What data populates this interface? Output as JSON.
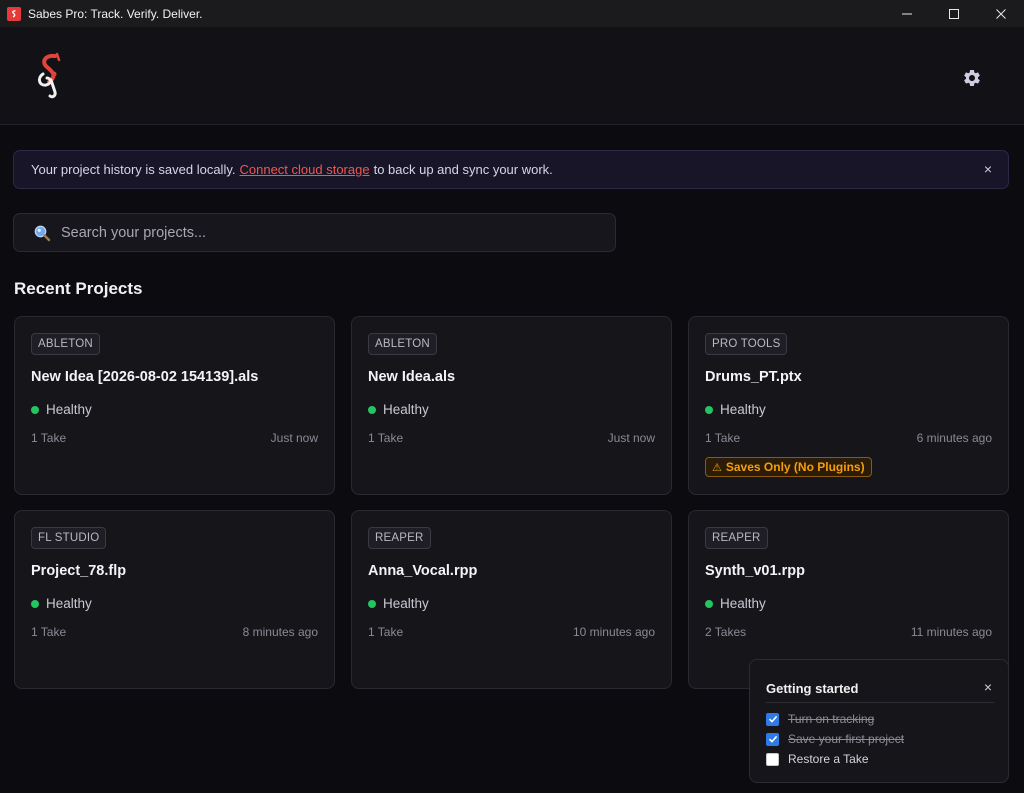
{
  "window": {
    "title": "Sabes Pro: Track. Verify. Deliver."
  },
  "header": {
    "logo_icon": "sabes-logo-icon",
    "settings_icon": "gear-icon"
  },
  "banner": {
    "text_before": "Your project history is saved locally.",
    "link": "Connect cloud storage",
    "text_after": "to back up and sync your work.",
    "close": "×"
  },
  "search": {
    "placeholder": "Search your projects..."
  },
  "recent": {
    "heading": "Recent Projects",
    "projects": [
      {
        "daw": "ABLETON",
        "name": "New Idea [2026-08-02 154139].als",
        "status": "Healthy",
        "takes": "1 Take",
        "time": "Just now"
      },
      {
        "daw": "ABLETON",
        "name": "New Idea.als",
        "status": "Healthy",
        "takes": "1 Take",
        "time": "Just now"
      },
      {
        "daw": "PRO TOOLS",
        "name": "Drums_PT.ptx",
        "status": "Healthy",
        "takes": "1 Take",
        "time": "6 minutes ago",
        "warning": "Saves Only (No Plugins)"
      },
      {
        "daw": "FL STUDIO",
        "name": "Project_78.flp",
        "status": "Healthy",
        "takes": "1 Take",
        "time": "8 minutes ago"
      },
      {
        "daw": "REAPER",
        "name": "Anna_Vocal.rpp",
        "status": "Healthy",
        "takes": "1 Take",
        "time": "10 minutes ago"
      },
      {
        "daw": "REAPER",
        "name": "Synth_v01.rpp",
        "status": "Healthy",
        "takes": "2 Takes",
        "time": "11 minutes ago"
      }
    ]
  },
  "getting_started": {
    "title": "Getting started",
    "close": "×",
    "items": [
      {
        "label": "Turn on tracking",
        "done": true
      },
      {
        "label": "Save your first project",
        "done": true
      },
      {
        "label": "Restore a Take",
        "done": false
      }
    ]
  },
  "colors": {
    "accent": "#f0574f",
    "healthy": "#22c55e",
    "warning": "#f59e0b",
    "checkbox": "#2f7be6"
  }
}
